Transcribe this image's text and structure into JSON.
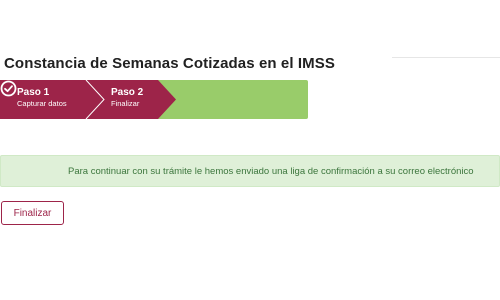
{
  "page": {
    "title": "Constancia de Semanas Cotizadas en el IMSS"
  },
  "stepper": {
    "steps": [
      {
        "label": "Paso 1",
        "sublabel": "Capturar datos",
        "color": "#9d2449"
      },
      {
        "label": "Paso 2",
        "sublabel": "Finalizar",
        "color": "#9d2449"
      }
    ],
    "complete_color": "#99cc6a",
    "complete_icon": "check-circle-icon"
  },
  "alert": {
    "message": "Para continuar con su trámite le hemos enviado una liga de confirmación a su correo electrónico",
    "background": "#dff0d8",
    "text_color": "#3c763d"
  },
  "actions": {
    "finish_label": "Finalizar",
    "accent_color": "#9d2449"
  }
}
